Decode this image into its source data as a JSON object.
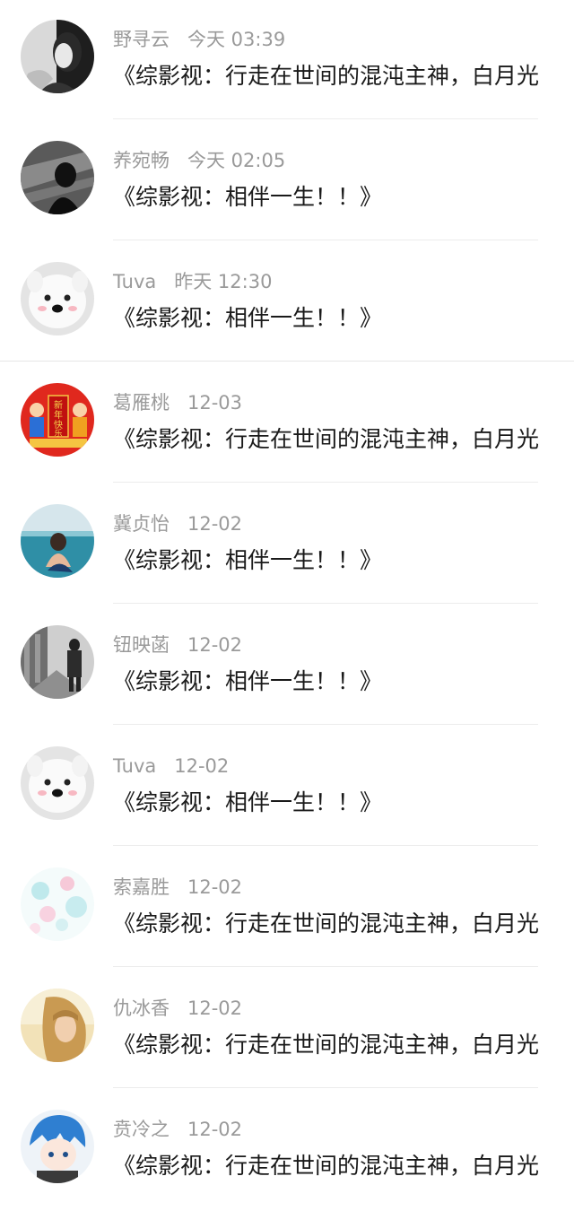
{
  "messages": [
    {
      "name": "野寻云",
      "time": "今天 03:39",
      "text": "《综影视：行走在世间的混沌主神，白月光",
      "avatar": "girl-bw-icon"
    },
    {
      "name": "养宛畅",
      "time": "今天 02:05",
      "text": "《综影视：相伴一生！！》",
      "avatar": "dark-figure-icon"
    },
    {
      "name": "Tuva",
      "time": "昨天 12:30",
      "text": "《综影视：相伴一生！！》",
      "avatar": "samoyed-dog-icon"
    },
    {
      "name": "葛雁桃",
      "time": "12-03",
      "text": "《综影视：行走在世间的混沌主神，白月光",
      "avatar": "new-year-icon"
    },
    {
      "name": "冀贞怡",
      "time": "12-02",
      "text": "《综影视：相伴一生！！》",
      "avatar": "sea-couple-icon"
    },
    {
      "name": "钮映菡",
      "time": "12-02",
      "text": "《综影视：相伴一生！！》",
      "avatar": "street-couple-icon"
    },
    {
      "name": "Tuva",
      "time": "12-02",
      "text": "《综影视：相伴一生！！》",
      "avatar": "samoyed-dog-icon"
    },
    {
      "name": "索嘉胜",
      "time": "12-02",
      "text": "《综影视：行走在世间的混沌主神，白月光",
      "avatar": "pastel-flowers-icon"
    },
    {
      "name": "仇冰香",
      "time": "12-02",
      "text": "《综影视：行走在世间的混沌主神，白月光",
      "avatar": "blonde-girl-icon"
    },
    {
      "name": "贲冷之",
      "time": "12-02",
      "text": "《综影视：行走在世间的混沌主神，白月光",
      "avatar": "anime-boy-icon"
    }
  ],
  "avatar_badge_text": "新年快乐",
  "colors": {
    "name_time": "#9a9a9a",
    "message": "#1a1a1a",
    "divider": "#ececec",
    "background": "#ffffff"
  }
}
